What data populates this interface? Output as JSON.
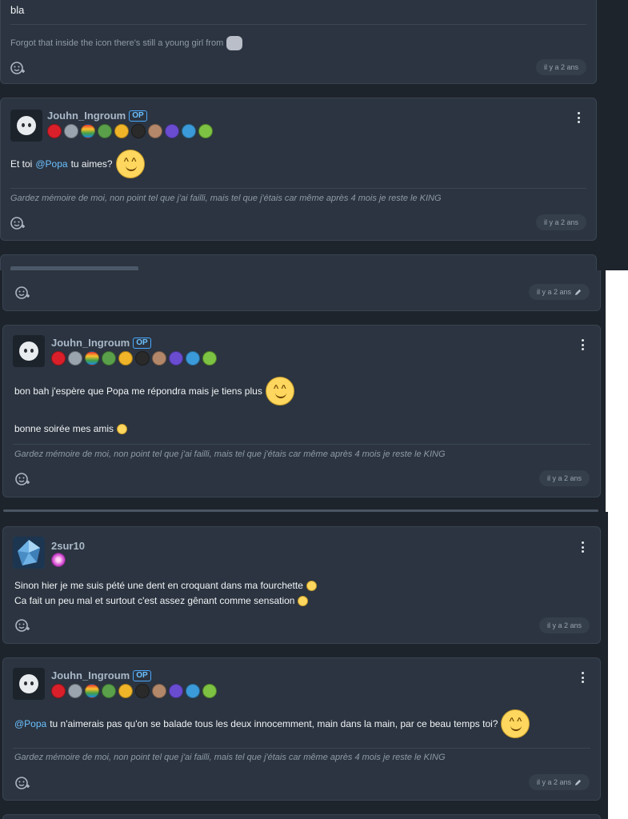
{
  "posts": [
    {
      "body": "bla",
      "signature_text": "Forgot that inside the icon there's still a young girl from",
      "date": "il y a 2 ans"
    },
    {
      "author": "Jouhn_Ingroum",
      "op_label": "OP",
      "text_prefix": "Et toi",
      "mention": "@Popa",
      "text_suffix": "tu aimes?",
      "signature": "Gardez mémoire de moi, non point tel que j'ai failli, mais tel que j'étais car même après 4 mois je reste le KING",
      "date": "il y a 2 ans"
    },
    {
      "date": "il y a 2 ans"
    },
    {
      "author": "Jouhn_Ingroum",
      "op_label": "OP",
      "line1": "bon bah j'espère que Popa me répondra mais je tiens plus",
      "line2": "bonne soirée mes amis",
      "signature": "Gardez mémoire de moi, non point tel que j'ai failli, mais tel que j'étais car même après 4 mois je reste le KING",
      "date": "il y a 2 ans"
    },
    {
      "author": "2sur10",
      "line1": "Sinon hier je me suis pété une dent en croquant dans ma fourchette",
      "line2": "Ca fait un peu mal et surtout c'est assez gênant comme sensation",
      "date": "il y a 2 ans"
    },
    {
      "author": "Jouhn_Ingroum",
      "op_label": "OP",
      "mention": "@Popa",
      "text": "tu n'aimerais pas qu'on se balade tous les deux innocemment, main dans la main, par ce beau temps toi?",
      "signature": "Gardez mémoire de moi, non point tel que j'ai failli, mais tel que j'étais car même après 4 mois je reste le KING",
      "date": "il y a 2 ans"
    }
  ],
  "badge_colors": [
    "#d9202a",
    "#9aa4ae",
    "#43b24b",
    "#5aa04a",
    "#f0b429",
    "#2a2a2a",
    "#b3876a",
    "#6a4cd1",
    "#3b9ad9",
    "#7dc242"
  ],
  "colors": {
    "card_bg": "#2b3440",
    "mention": "#6cc0ff",
    "username": "#aab8c8",
    "signature": "#8f9aa8"
  },
  "icons": {
    "reaction": "emoji-add-icon",
    "menu": "kebab-menu-icon",
    "edited": "pencil-icon"
  }
}
